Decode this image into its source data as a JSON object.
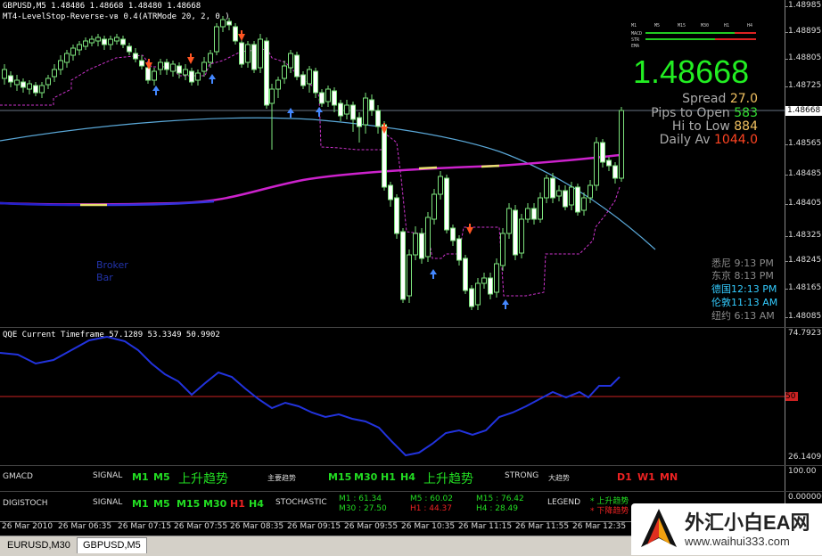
{
  "main": {
    "symbol_line": "GBPUSD,M5  1.48486  1.48668  1.48480  1.48668",
    "indicator_line": "MT4-LevelStop-Reverse-vв 0.4(ATRMode 20, 2, 0 )",
    "price_labels": [
      "1.48985",
      "1.48895",
      "1.48805",
      "1.48725",
      "1.48668",
      "1.48565",
      "1.48485",
      "1.48405",
      "1.48325",
      "1.48245",
      "1.48165",
      "1.48085"
    ],
    "current_price_marker": "1.48668",
    "broker_text": "Broker",
    "bar_text": "Bar",
    "big_price": "1.48668",
    "mini_panel_labels": [
      "M1",
      "M5",
      "M15",
      "M30",
      "H1",
      "H4"
    ],
    "mini_panel_rows": [
      "MACD",
      "STR",
      "EMA"
    ],
    "stats": [
      {
        "label": "Spread",
        "value": "27.0",
        "color": "#f0c060"
      },
      {
        "label": "Pips to Open",
        "value": "583",
        "color": "#33dd33"
      },
      {
        "label": "Hi to Low",
        "value": "884",
        "color": "#f0c060"
      },
      {
        "label": "Daily Av",
        "value": "1044.0",
        "color": "#ff4422"
      }
    ],
    "timezones": [
      {
        "city": "悉尼",
        "time": "9:13 PM",
        "color": "#8a8a8a"
      },
      {
        "city": "东京",
        "time": "8:13 PM",
        "color": "#8a8a8a"
      },
      {
        "city": "德国",
        "time": "12:13 PM",
        "color": "#33ccff"
      },
      {
        "city": "伦敦",
        "time": "11:13 AM",
        "color": "#33ccff"
      },
      {
        "city": "纽约",
        "time": "6:13 AM",
        "color": "#8a8a8a"
      }
    ]
  },
  "qqe": {
    "title": "QQE Current Timeframe 57.1289 53.3349 50.9902",
    "labels": [
      "74.7923",
      "50",
      "26.1409"
    ]
  },
  "gmacd": {
    "name": "GMACD",
    "signal_label": "SIGNAL",
    "tf1": "M1",
    "tf2": "M5",
    "trend_up": "上升趋势",
    "main_trend": "主要趋势",
    "tf3": "M15",
    "tf4": "M30",
    "tf5": "H1",
    "tf6": "H4",
    "trend_up2": "上升趋势",
    "strong": "STRONG",
    "big_trend": "大趋势",
    "d1": "D1",
    "w1": "W1",
    "mn": "MN",
    "right_label": "100.00"
  },
  "digistoch": {
    "name": "DIGISTOCH",
    "signal_label": "SIGNAL",
    "tfs": [
      "M1",
      "M5",
      "M15",
      "M30"
    ],
    "h1": "H1",
    "h4": "H4",
    "stochastic": "STOCHASTIC",
    "s_m1": "M1 : 61.34",
    "s_m30": "M30 : 27.50",
    "s_m5": "M5 : 60.02",
    "s_h1": "H1 : 44.37",
    "s_m15": "M15 : 76.42",
    "s_h4": "H4 : 28.49",
    "legend": "LEGEND",
    "legend_up": "* 上升趋势",
    "legend_down": "* 下降趋势",
    "right_label": "0.000000"
  },
  "time_axis": [
    "26 Mar 2010",
    "26 Mar 06:35",
    "26 Mar 07:15",
    "26 Mar 07:55",
    "26 Mar 08:35",
    "26 Mar 09:15",
    "26 Mar 09:55",
    "26 Mar 10:35",
    "26 Mar 11:15",
    "26 Mar 11:55",
    "26 Mar 12:35"
  ],
  "tabs": [
    "EURUSD,M30",
    "GBPUSD,M5"
  ],
  "watermark": {
    "name": "外汇小白EA网",
    "url": "www.waihui333.com"
  }
}
